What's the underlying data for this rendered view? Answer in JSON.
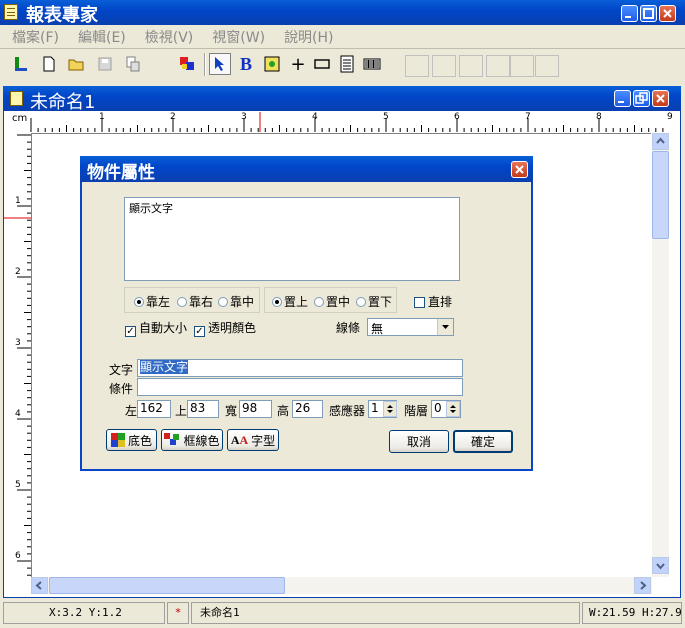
{
  "app": {
    "title": "報表專家"
  },
  "menu": [
    "檔案(F)",
    "編輯(E)",
    "檢視(V)",
    "視窗(W)",
    "說明(H)"
  ],
  "doc": {
    "title": "未命名1"
  },
  "ruler": {
    "unit": "cm",
    "top_numbers": [
      "1",
      "2",
      "3",
      "4",
      "5",
      "6",
      "7",
      "8",
      "9"
    ],
    "left_numbers": [
      "1",
      "2",
      "3",
      "4",
      "5",
      "6"
    ]
  },
  "dialog": {
    "title": "物件屬性",
    "text_area_value": "顯示文字",
    "radio_h": [
      "靠左",
      "靠右",
      "靠中"
    ],
    "radio_v": [
      "置上",
      "置中",
      "置下"
    ],
    "vertical_label": "直排",
    "auto_size_label": "自動大小",
    "transparent_label": "透明顏色",
    "line_label": "線條",
    "line_value": "無",
    "text_label": "文字",
    "text_value": "顯示文字",
    "condition_label": "條件",
    "condition_value": "",
    "left_label": "左",
    "left_value": "162",
    "top_label": "上",
    "top_value": "83",
    "width_label": "寬",
    "width_value": "98",
    "height_label": "高",
    "height_value": "26",
    "sensor_label": "感應器",
    "sensor_value": "1",
    "layer_label": "階層",
    "layer_value": "0",
    "bgcolor_label": "底色",
    "border_color_label": "框線色",
    "font_label": "字型",
    "cancel_label": "取消",
    "ok_label": "確定"
  },
  "status": {
    "coords": "X:3.2 Y:1.2",
    "modified": "*",
    "filename": "未命名1",
    "size": "W:21.59 H:27.94"
  }
}
